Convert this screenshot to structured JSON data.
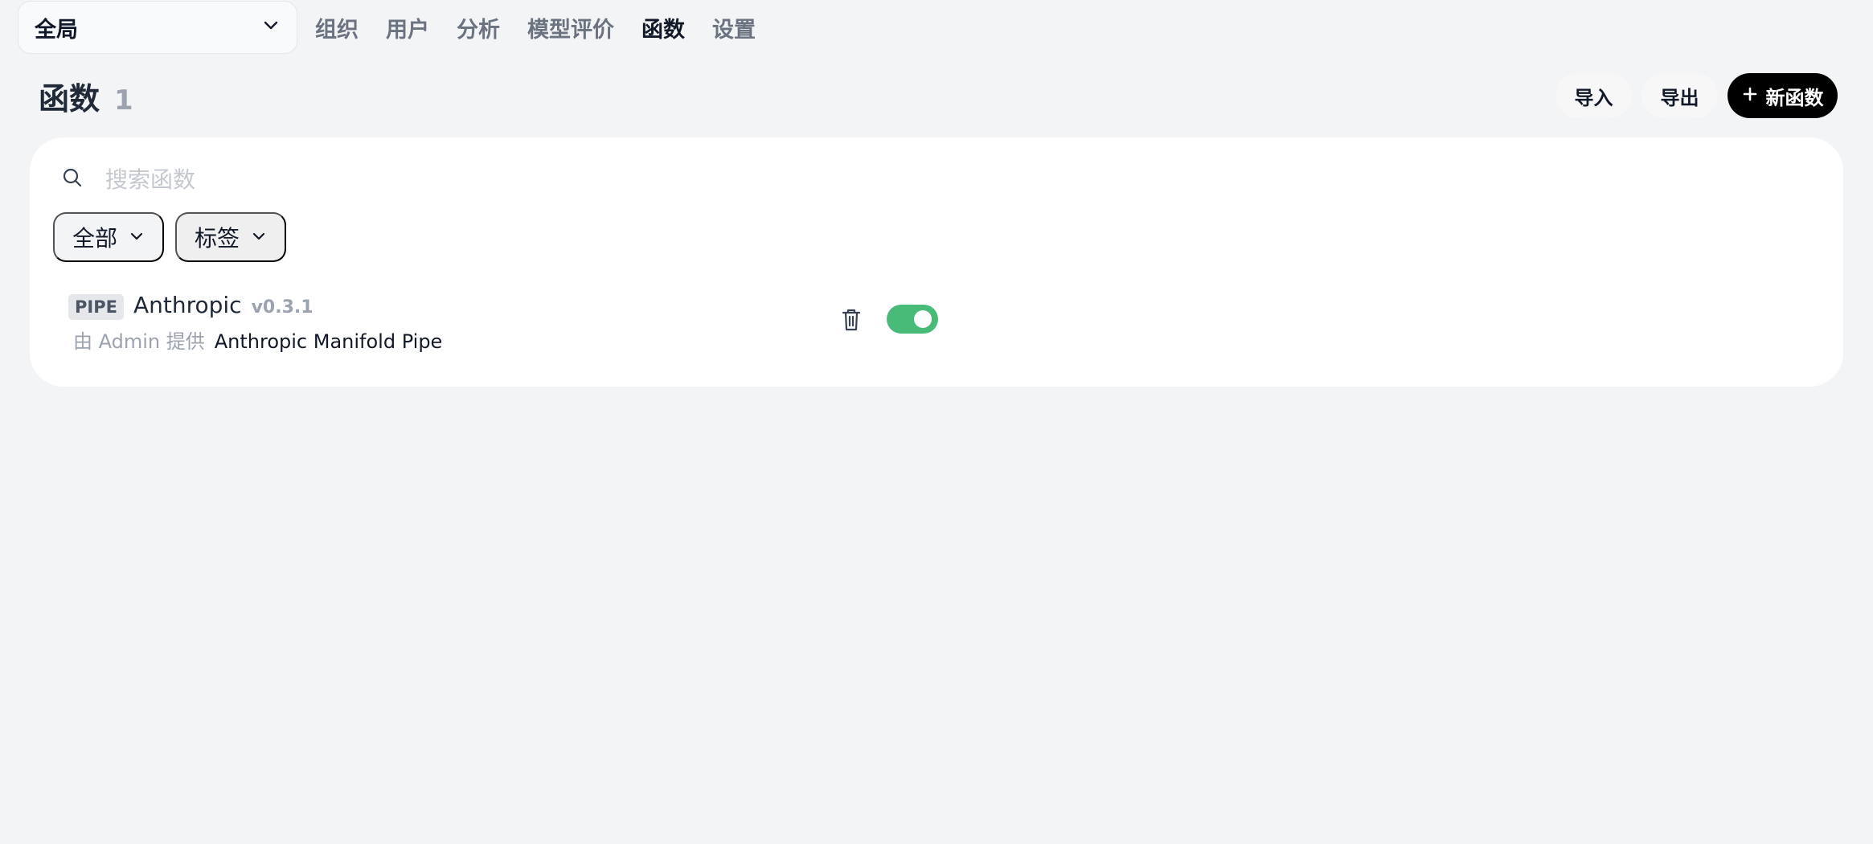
{
  "topbar": {
    "scope": "全局",
    "nav": [
      "组织",
      "用户",
      "分析",
      "模型评价",
      "函数",
      "设置"
    ],
    "active_nav": "函数"
  },
  "header": {
    "title": "函数",
    "count": "1",
    "actions": {
      "import": "导入",
      "export": "导出",
      "new": "新函数"
    }
  },
  "search": {
    "placeholder": "搜索函数",
    "value": ""
  },
  "filters": {
    "all": "全部",
    "tags": "标签"
  },
  "functions": [
    {
      "type": "PIPE",
      "name": "Anthropic",
      "version": "v0.3.1",
      "author": "由 Admin 提供",
      "description": "Anthropic Manifold Pipe",
      "enabled": true
    }
  ],
  "icons": {
    "dropdown": "chevron-down-icon",
    "search": "search-icon",
    "plus": "plus-icon",
    "delete": "trash-icon"
  },
  "colors": {
    "background": "#f3f4f6",
    "primary_button": "#000000",
    "toggle_on": "#48bb78",
    "muted_text": "#9ca3af"
  }
}
